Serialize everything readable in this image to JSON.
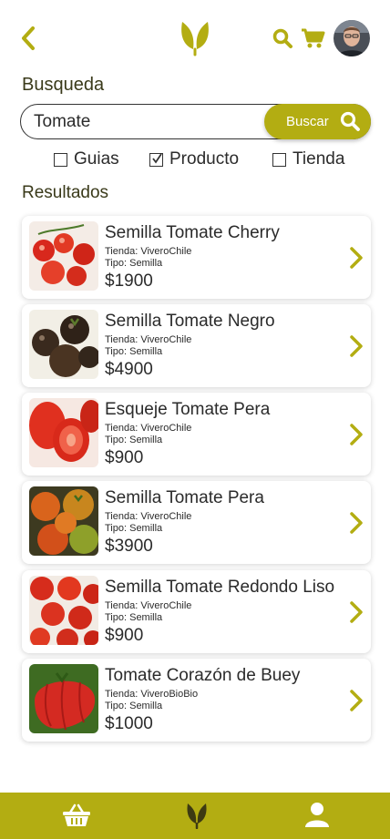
{
  "colors": {
    "accent": "#b3ad12",
    "text": "#2b2b2b"
  },
  "header": {
    "back_icon": "chevron-left-icon",
    "logo_icon": "leaf-logo-icon",
    "search_icon": "search-icon",
    "cart_icon": "cart-icon"
  },
  "search": {
    "label": "Busqueda",
    "value": "Tomate",
    "button_label": "Buscar"
  },
  "filters": [
    {
      "label": "Guias",
      "checked": false
    },
    {
      "label": "Producto",
      "checked": true
    },
    {
      "label": "Tienda",
      "checked": false
    }
  ],
  "results": {
    "label": "Resultados",
    "items": [
      {
        "name": "Semilla Tomate Cherry",
        "store": "Tienda: ViveroChile",
        "type": "Tipo: Semilla",
        "price": "$1900"
      },
      {
        "name": "Semilla Tomate Negro",
        "store": "Tienda: ViveroChile",
        "type": "Tipo: Semilla",
        "price": "$4900"
      },
      {
        "name": "Esqueje Tomate Pera",
        "store": "Tienda: ViveroChile",
        "type": "Tipo: Semilla",
        "price": "$900"
      },
      {
        "name": "Semilla Tomate Pera",
        "store": "Tienda: ViveroChile",
        "type": "Tipo: Semilla",
        "price": "$3900"
      },
      {
        "name": "Semilla Tomate Redondo Liso",
        "store": "Tienda: ViveroChile",
        "type": "Tipo: Semilla",
        "price": "$900"
      },
      {
        "name": "Tomate Corazón de Buey",
        "store": "Tienda: ViveroBioBio",
        "type": "Tipo: Semilla",
        "price": "$1000"
      }
    ]
  },
  "bottom_nav": {
    "shop_icon": "basket-icon",
    "home_icon": "leaf-icon",
    "profile_icon": "user-icon"
  }
}
